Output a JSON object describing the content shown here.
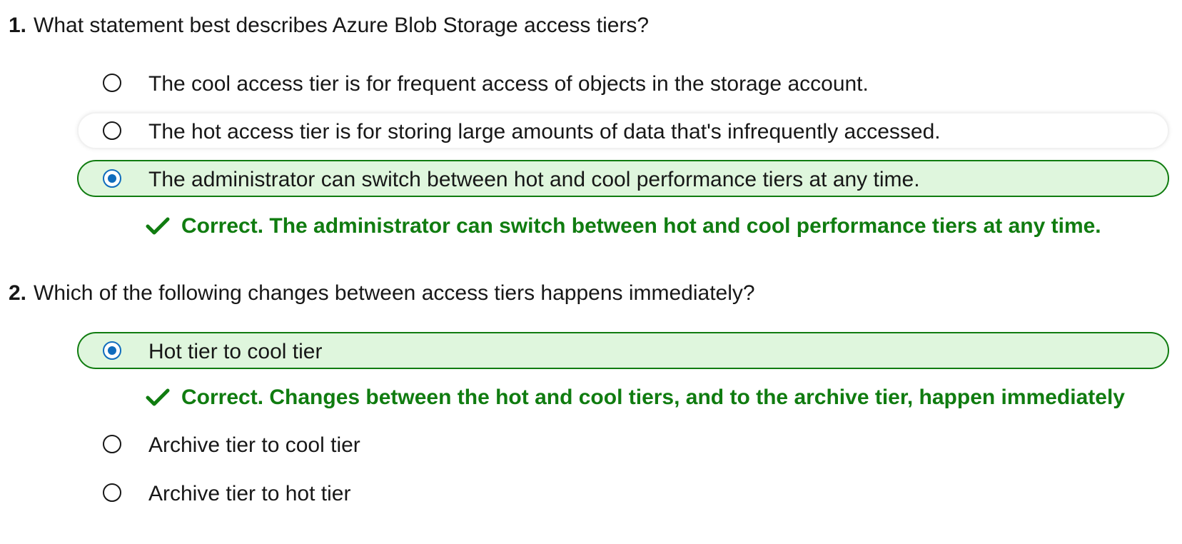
{
  "questions": [
    {
      "number": "1.",
      "text": "What statement best describes Azure Blob Storage access tiers?",
      "options": [
        {
          "label": "The cool access tier is for frequent access of objects in the storage account.",
          "selected": false
        },
        {
          "label": "The hot access tier is for storing large amounts of data that's infrequently accessed.",
          "selected": false
        },
        {
          "label": "The administrator can switch between hot and cool performance tiers at any time.",
          "selected": true
        }
      ],
      "feedback": "Correct. The administrator can switch between hot and cool performance tiers at any time."
    },
    {
      "number": "2.",
      "text": "Which of the following changes between access tiers happens immediately?",
      "options": [
        {
          "label": "Hot tier to cool tier",
          "selected": true
        },
        {
          "label": "Archive tier to cool tier",
          "selected": false
        },
        {
          "label": "Archive tier to hot tier",
          "selected": false
        }
      ],
      "feedback": "Correct. Changes between the hot and cool tiers, and to the archive tier, happen immediately"
    }
  ],
  "colors": {
    "correct": "#107c10",
    "selected_background": "#dff6dd",
    "radio_checked": "#0f6cbd"
  },
  "icons": {
    "radio": "radio-button",
    "feedback": "checkmark-icon"
  }
}
